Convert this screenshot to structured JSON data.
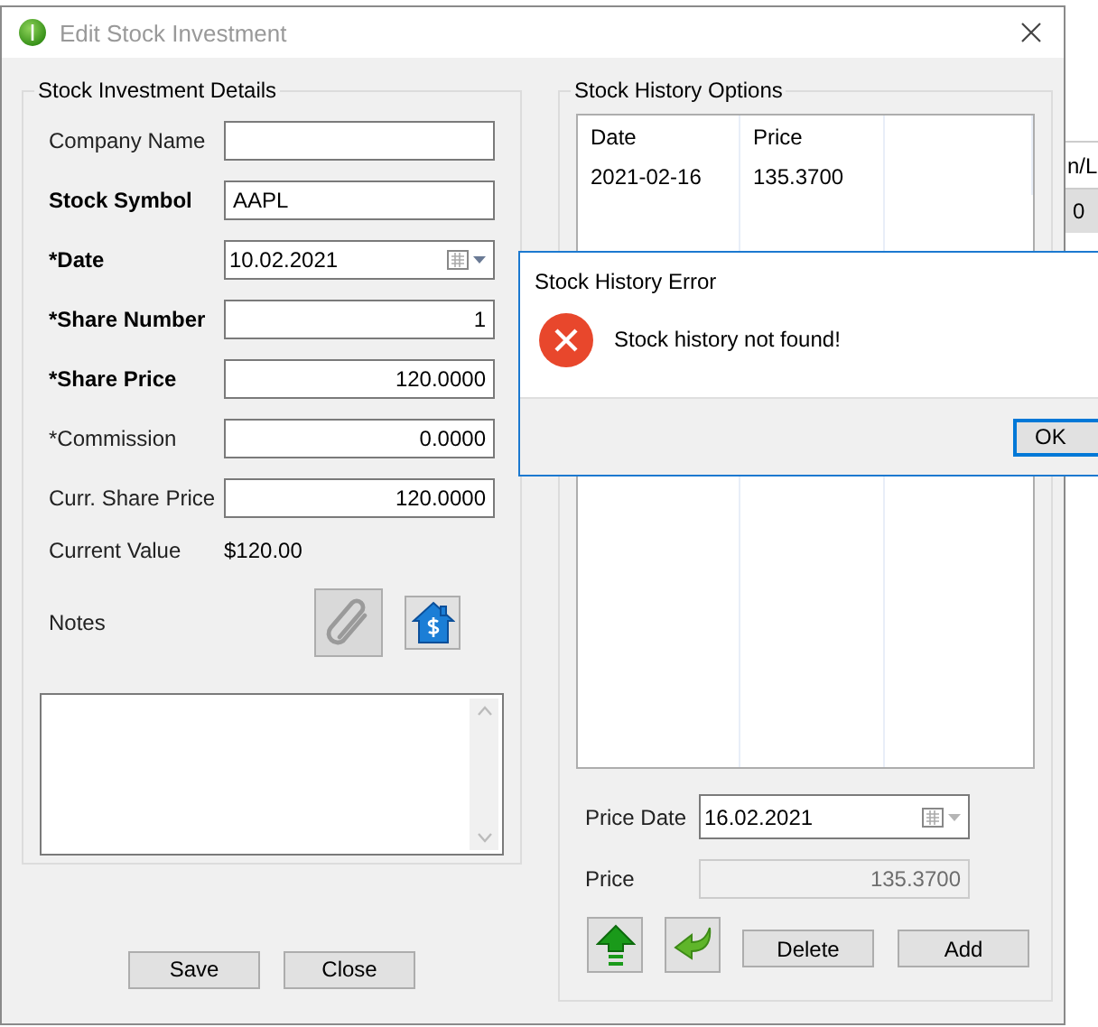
{
  "window": {
    "title": "Edit Stock Investment"
  },
  "details": {
    "title": "Stock Investment Details",
    "fields": [
      {
        "label": "Company Name",
        "bold": false,
        "kind": "text"
      },
      {
        "label": "Stock Symbol",
        "bold": true,
        "kind": "text",
        "value": "AAPL"
      },
      {
        "label": "*Date",
        "bold": true,
        "kind": "date",
        "value": "10.02.2021"
      },
      {
        "label": "*Share Number",
        "bold": true,
        "kind": "number",
        "value": "1"
      },
      {
        "label": "*Share Price",
        "bold": true,
        "kind": "number",
        "value": "120.0000"
      },
      {
        "label": "*Commission",
        "bold": false,
        "kind": "number",
        "value": "0.0000"
      },
      {
        "label": "Curr. Share Price",
        "bold": false,
        "kind": "number",
        "value": "120.0000"
      },
      {
        "label": "Current Value",
        "bold": false,
        "kind": "readout",
        "value": "$120.00"
      }
    ],
    "notes": {
      "label": "Notes"
    }
  },
  "buttons": [
    "Save",
    "Close"
  ],
  "history": {
    "title": "Stock History Options",
    "columns": [
      "Date",
      "Price"
    ],
    "rows": [
      [
        "2021-02-16",
        "135.3700"
      ]
    ],
    "price_date": {
      "label": "Price Date",
      "value": "16.02.2021"
    },
    "price": {
      "label": "Price",
      "value": "135.3700",
      "disabled": true
    },
    "buttons": [
      "Delete",
      "Add"
    ]
  },
  "error_dialog": {
    "title": "Stock History Error",
    "message": "Stock history not found!",
    "button": "OK"
  },
  "background_window": {
    "cells": [
      "n/L",
      "0"
    ]
  }
}
